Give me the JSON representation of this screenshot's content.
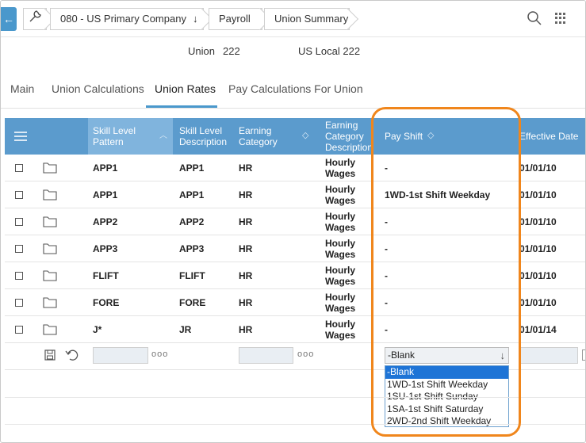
{
  "breadcrumb": {
    "company": "080 - US Primary Company",
    "payroll": "Payroll",
    "union_summary": "Union Summary"
  },
  "info": {
    "label": "Union",
    "number": "222",
    "local": "US Local 222"
  },
  "tabs": [
    {
      "label": "Main",
      "active": false
    },
    {
      "label": "Union Calculations",
      "active": false
    },
    {
      "label": "Union Rates",
      "active": true
    },
    {
      "label": "Pay Calculations For Union",
      "active": false
    }
  ],
  "columns": {
    "skill_level_pattern": "Skill Level Pattern",
    "skill_level_description": "Skill Level Description",
    "earning_category": "Earning Category",
    "earning_category_description": "Earning Category Description",
    "pay_shift": "Pay Shift",
    "effective_date": "Effective Date"
  },
  "rows": [
    {
      "pattern": "APP1",
      "description": "APP1",
      "category": "HR",
      "category_desc": "Hourly Wages",
      "pay_shift": "-",
      "effective": "01/01/10"
    },
    {
      "pattern": "APP1",
      "description": "APP1",
      "category": "HR",
      "category_desc": "Hourly Wages",
      "pay_shift": "1WD-1st Shift Weekday",
      "effective": "01/01/10"
    },
    {
      "pattern": "APP2",
      "description": "APP2",
      "category": "HR",
      "category_desc": "Hourly Wages",
      "pay_shift": "-",
      "effective": "01/01/10"
    },
    {
      "pattern": "APP3",
      "description": "APP3",
      "category": "HR",
      "category_desc": "Hourly Wages",
      "pay_shift": "-",
      "effective": "01/01/10"
    },
    {
      "pattern": "FLIFT",
      "description": "FLIFT",
      "category": "HR",
      "category_desc": "Hourly Wages",
      "pay_shift": "-",
      "effective": "01/01/10"
    },
    {
      "pattern": "FORE",
      "description": "FORE",
      "category": "HR",
      "category_desc": "Hourly Wages",
      "pay_shift": "-",
      "effective": "01/01/10"
    },
    {
      "pattern": "J*",
      "description": "JR",
      "category": "HR",
      "category_desc": "Hourly Wages",
      "pay_shift": "-",
      "effective": "01/01/14"
    }
  ],
  "edit_row": {
    "ellipsis": "ooo",
    "pay_shift_selected": "-Blank",
    "pay_shift_options": [
      "-Blank",
      "1WD-1st Shift Weekday",
      "1SU-1st Shift Sunday",
      "1SA-1st Shift Saturday",
      "2WD-2nd Shift Weekday"
    ]
  },
  "colors": {
    "header_blue": "#5b9bcd",
    "sorted_header": "#80b4dd",
    "accent": "#4a98cc",
    "highlight": "#f0861c",
    "option_selected": "#1e74d6"
  }
}
